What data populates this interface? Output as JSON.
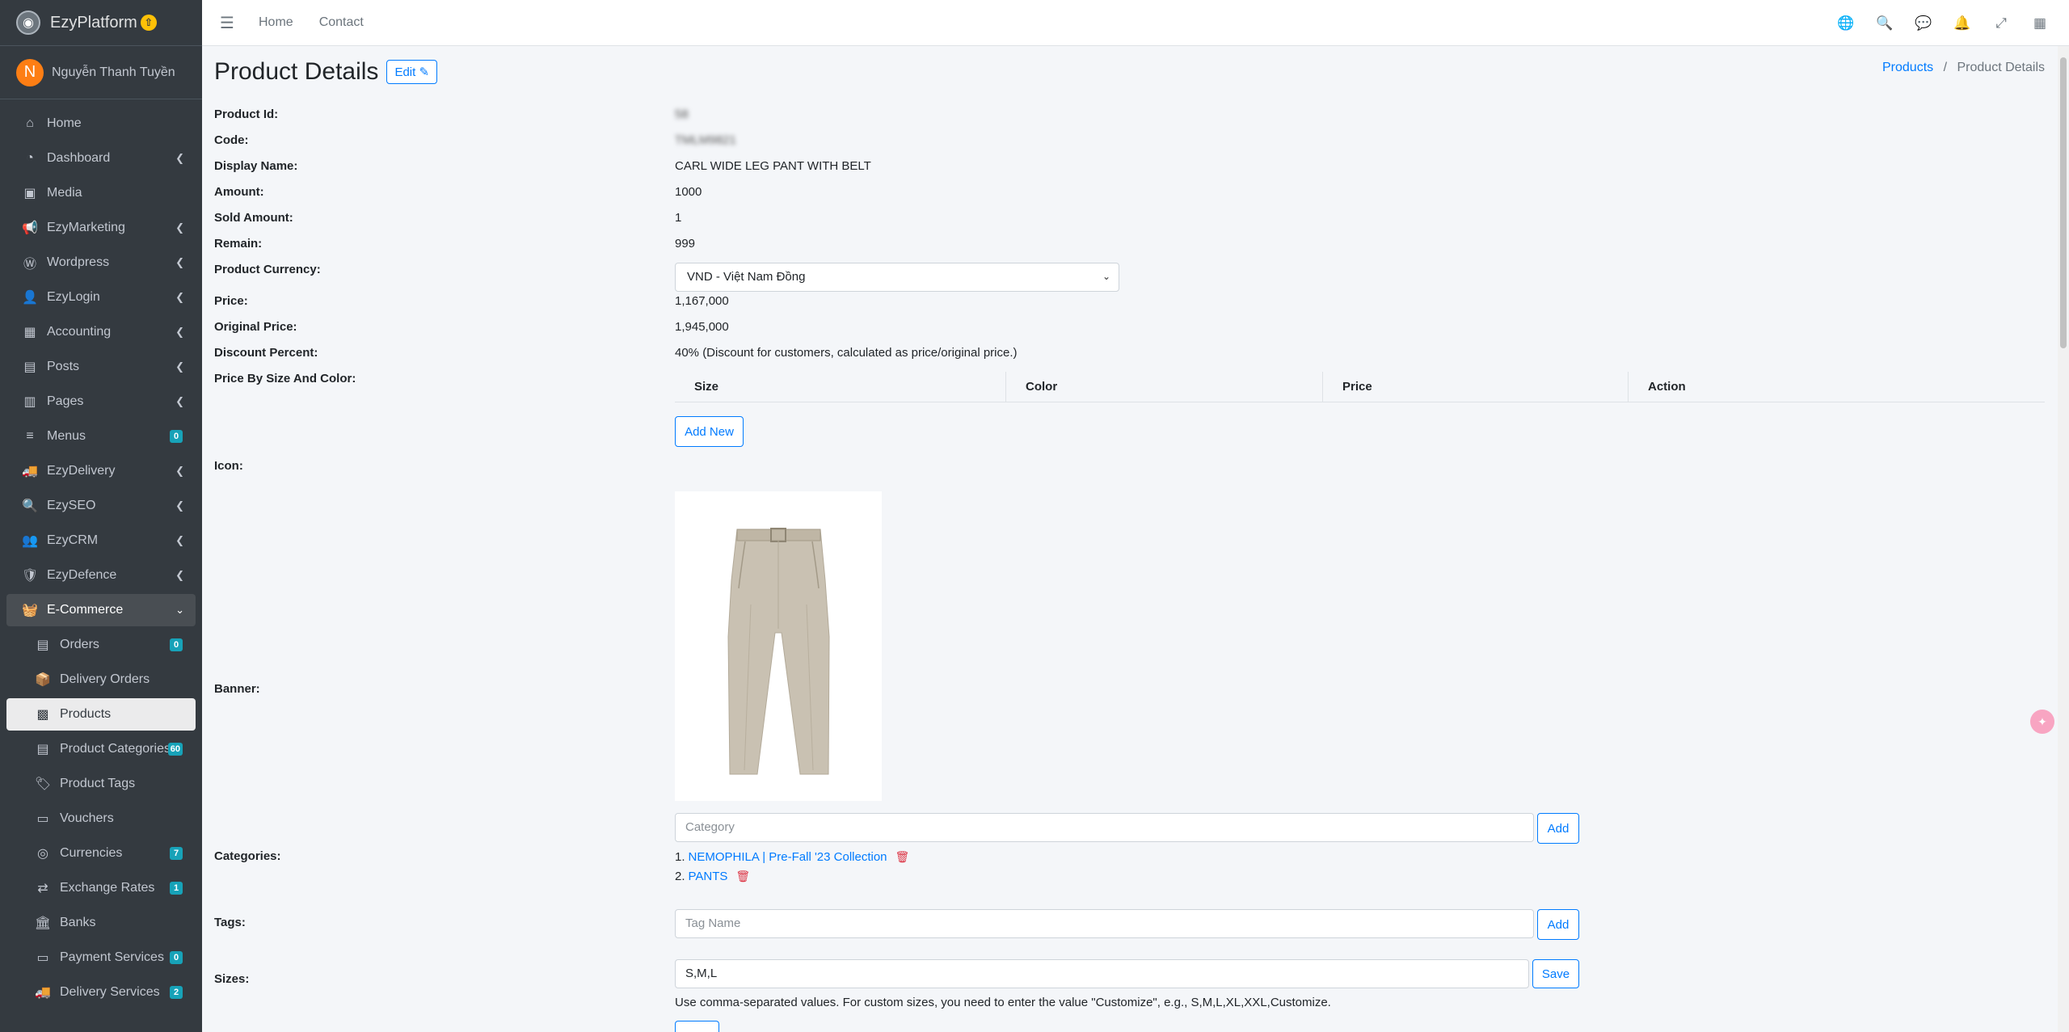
{
  "brand": {
    "name": "EzyPlatform",
    "badge": "⇧"
  },
  "user": {
    "initial": "N",
    "name": "Nguyễn Thanh Tuyền"
  },
  "sidebar": {
    "items": [
      {
        "label": "Home",
        "icon": "home-icon",
        "glyph": "⌂",
        "caret": false
      },
      {
        "label": "Dashboard",
        "icon": "dashboard-icon",
        "glyph": "◔",
        "caret": true
      },
      {
        "label": "Media",
        "icon": "image-icon",
        "glyph": "▣",
        "caret": false
      },
      {
        "label": "EzyMarketing",
        "icon": "megaphone-icon",
        "glyph": "📢",
        "caret": true
      },
      {
        "label": "Wordpress",
        "icon": "wordpress-icon",
        "glyph": "Ⓦ",
        "caret": true
      },
      {
        "label": "EzyLogin",
        "icon": "user-lock-icon",
        "glyph": "👤",
        "caret": true
      },
      {
        "label": "Accounting",
        "icon": "calculator-icon",
        "glyph": "▦",
        "caret": true
      },
      {
        "label": "Posts",
        "icon": "newspaper-icon",
        "glyph": "▤",
        "caret": true
      },
      {
        "label": "Pages",
        "icon": "book-icon",
        "glyph": "▥",
        "caret": true
      },
      {
        "label": "Menus",
        "icon": "bars-icon",
        "glyph": "≡",
        "caret": false,
        "badge": "0"
      },
      {
        "label": "EzyDelivery",
        "icon": "truck-icon",
        "glyph": "🚚",
        "caret": true
      },
      {
        "label": "EzySEO",
        "icon": "search-plus-icon",
        "glyph": "🔍",
        "caret": true
      },
      {
        "label": "EzyCRM",
        "icon": "users-cog-icon",
        "glyph": "👥",
        "caret": true
      },
      {
        "label": "EzyDefence",
        "icon": "shield-icon",
        "glyph": "🛡",
        "caret": true
      }
    ],
    "open_section": {
      "label": "E-Commerce",
      "icon": "shopping-basket-icon",
      "glyph": "🧺"
    },
    "sub_items": [
      {
        "label": "Orders",
        "icon": "receipt-icon",
        "glyph": "▤",
        "badge": "0"
      },
      {
        "label": "Delivery Orders",
        "icon": "truck-loading-icon",
        "glyph": "📦"
      },
      {
        "label": "Products",
        "icon": "boxes-icon",
        "glyph": "▩",
        "active": true
      },
      {
        "label": "Product Categories",
        "icon": "clipboard-list-icon",
        "glyph": "▤",
        "badge": "60"
      },
      {
        "label": "Product Tags",
        "icon": "tags-icon",
        "glyph": "🏷"
      },
      {
        "label": "Vouchers",
        "icon": "ticket-icon",
        "glyph": "▭"
      },
      {
        "label": "Currencies",
        "icon": "coins-icon",
        "glyph": "◎",
        "badge": "7"
      },
      {
        "label": "Exchange Rates",
        "icon": "exchange-icon",
        "glyph": "⇄",
        "badge": "1"
      },
      {
        "label": "Banks",
        "icon": "bank-icon",
        "glyph": "🏛"
      },
      {
        "label": "Payment Services",
        "icon": "credit-card-icon",
        "glyph": "▭",
        "badge": "0"
      },
      {
        "label": "Delivery Services",
        "icon": "shipping-fast-icon",
        "glyph": "🚚",
        "badge": "2"
      }
    ]
  },
  "header": {
    "links": [
      "Home",
      "Contact"
    ],
    "icons": [
      {
        "name": "globe-icon",
        "glyph": "🌐"
      },
      {
        "name": "search-icon",
        "glyph": "🔍"
      },
      {
        "name": "comments-icon",
        "glyph": "💬"
      },
      {
        "name": "bell-icon",
        "glyph": "🔔"
      },
      {
        "name": "expand-icon",
        "glyph": "⤢"
      },
      {
        "name": "grid-icon",
        "glyph": "▦"
      }
    ]
  },
  "page": {
    "title": "Product Details",
    "edit_label": "Edit",
    "breadcrumb": {
      "parent": "Products",
      "separator": "/",
      "current": "Product Details"
    }
  },
  "details": {
    "product_id_label": "Product Id:",
    "product_id": "58",
    "code_label": "Code:",
    "code": "TMLM9821",
    "display_name_label": "Display Name:",
    "display_name": "CARL WIDE LEG PANT WITH BELT",
    "amount_label": "Amount:",
    "amount": "1000",
    "sold_label": "Sold Amount:",
    "sold": "1",
    "remain_label": "Remain:",
    "remain": "999",
    "currency_label": "Product Currency:",
    "currency": "VND - Việt Nam Đồng",
    "price_label": "Price:",
    "price": "1,167,000",
    "original_price_label": "Original Price:",
    "original_price": "1,945,000",
    "discount_label": "Discount Percent:",
    "discount": "40% (Discount for customers, calculated as price/original price.)",
    "price_by_label": "Price By Size And Color:",
    "price_table_headers": [
      "Size",
      "Color",
      "Price",
      "Action"
    ],
    "add_new_label": "Add New",
    "icon_label": "Icon:",
    "banner_label": "Banner:",
    "categories_label": "Categories:",
    "category_placeholder": "Category",
    "add_label": "Add",
    "categories": [
      {
        "index": "1.",
        "name": "NEMOPHILA | Pre-Fall '23 Collection"
      },
      {
        "index": "2.",
        "name": "PANTS"
      }
    ],
    "tags_label": "Tags:",
    "tag_placeholder": "Tag Name",
    "sizes_label": "Sizes:",
    "sizes_value": "S,M,L",
    "save_label": "Save",
    "sizes_hint": "Use comma-separated values. For custom sizes, you need to enter the value \"Customize\", e.g., S,M,L,XL,XXL,Customize."
  }
}
